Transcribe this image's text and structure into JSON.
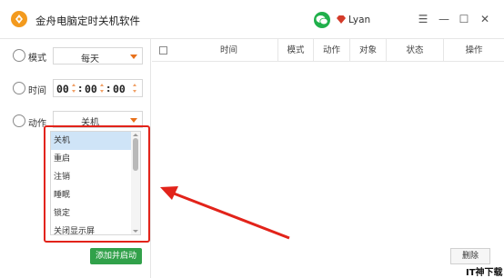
{
  "app": {
    "title": "金舟电脑定时关机软件",
    "username": "Lyan"
  },
  "controls": {
    "mode_label": "模式",
    "mode_value": "每天",
    "time_label": "时间",
    "hour": "00",
    "minute": "00",
    "second": "00",
    "action_label": "动作",
    "action_value": "关机"
  },
  "dropdown": {
    "options": [
      "关机",
      "重启",
      "注销",
      "睡眠",
      "锁定",
      "关闭显示屏"
    ],
    "selected": "关机"
  },
  "buttons": {
    "add_label": "添加并启动",
    "delete_label": "删除"
  },
  "table": {
    "columns": [
      "时间",
      "模式",
      "动作",
      "对象",
      "状态",
      "操作"
    ]
  },
  "watermark": "IT神下载网",
  "colors": {
    "accent": "#f39a1e",
    "green": "#31a14a",
    "highlight": "#e2231a",
    "selection": "#cfe4f7"
  }
}
